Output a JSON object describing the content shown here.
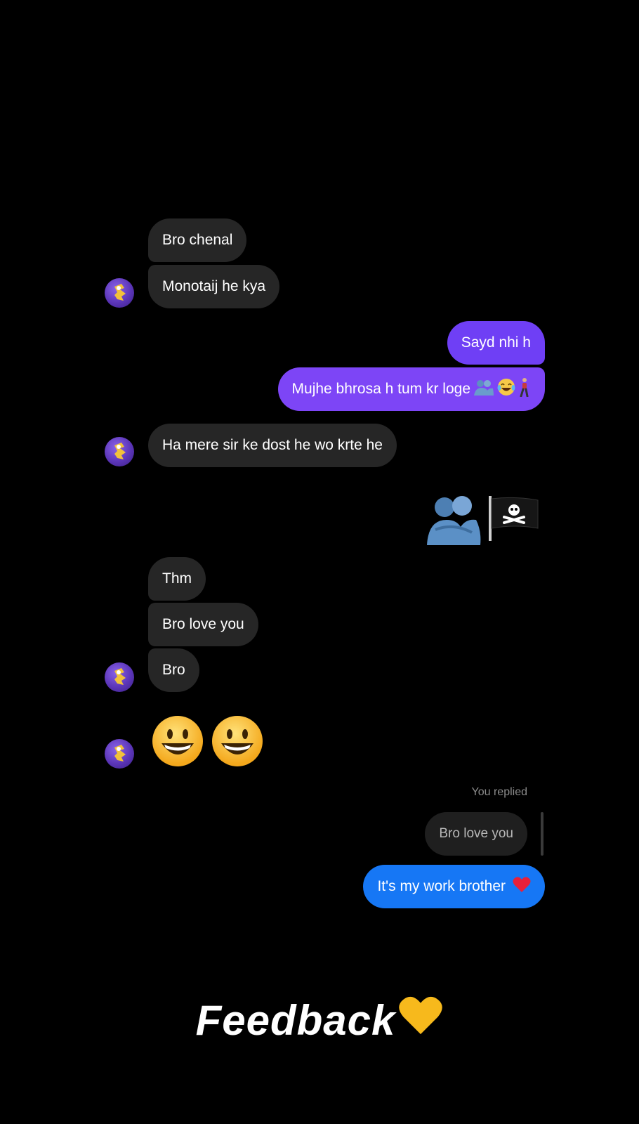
{
  "messages": {
    "m1": "Bro chenal",
    "m2": "Monotaij he kya",
    "m3": "Sayd nhi h",
    "m4": "Mujhe bhrosa h tum kr loge",
    "m5": "Ha mere sir ke dost he wo krte he",
    "m6": "Thm",
    "m7": "Bro love you",
    "m8": "Bro",
    "reply_label": "You replied",
    "reply_quote": "Bro love you",
    "reply_text": "It's my work brother"
  },
  "emojis": {
    "m4": [
      "people-hugging",
      "face-with-tears-of-joy",
      "person-walking"
    ],
    "sent_sticker": [
      "people-hugging",
      "pirate-flag"
    ],
    "recv_sticker": [
      "grinning-face",
      "grinning-face"
    ],
    "reply": "red-heart",
    "caption": "yellow-heart"
  },
  "caption": "Feedback",
  "colors": {
    "background": "#000000",
    "received_bubble": "#262626",
    "sent_bubble": "#7a42f5",
    "reply_bubble": "#1677f5"
  }
}
